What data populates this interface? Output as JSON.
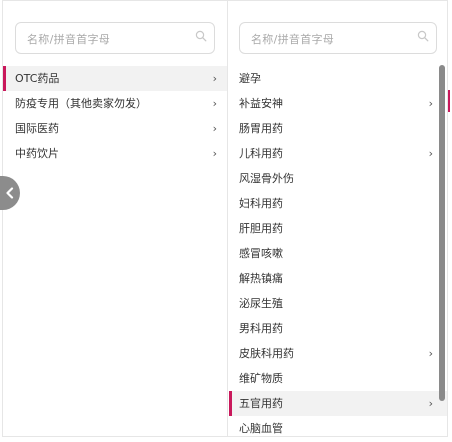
{
  "left": {
    "search_placeholder": "名称/拼音首字母",
    "items": [
      {
        "label": "OTC药品",
        "chevron": "›",
        "active": true
      },
      {
        "label": "防疫专用（其他卖家勿发）",
        "chevron": "›",
        "active": false
      },
      {
        "label": "国际医药",
        "chevron": "›",
        "active": false
      },
      {
        "label": "中药饮片",
        "chevron": "›",
        "active": false
      }
    ]
  },
  "right": {
    "search_placeholder": "名称/拼音首字母",
    "items": [
      {
        "label": "避孕",
        "chevron": "",
        "active": false
      },
      {
        "label": "补益安神",
        "chevron": "›",
        "active": false
      },
      {
        "label": "肠胃用药",
        "chevron": "",
        "active": false
      },
      {
        "label": "儿科用药",
        "chevron": "›",
        "active": false
      },
      {
        "label": "风湿骨外伤",
        "chevron": "",
        "active": false
      },
      {
        "label": "妇科用药",
        "chevron": "",
        "active": false
      },
      {
        "label": "肝胆用药",
        "chevron": "",
        "active": false
      },
      {
        "label": "感冒咳嗽",
        "chevron": "",
        "active": false
      },
      {
        "label": "解热镇痛",
        "chevron": "",
        "active": false
      },
      {
        "label": "泌尿生殖",
        "chevron": "",
        "active": false
      },
      {
        "label": "男科用药",
        "chevron": "",
        "active": false
      },
      {
        "label": "皮肤科用药",
        "chevron": "›",
        "active": false
      },
      {
        "label": "维矿物质",
        "chevron": "",
        "active": false
      },
      {
        "label": "五官用药",
        "chevron": "›",
        "active": true
      },
      {
        "label": "心脑血管",
        "chevron": "",
        "active": false
      }
    ]
  },
  "icons": {
    "search": "search-icon",
    "collapse": "chevron-left-icon"
  },
  "colors": {
    "accent": "#c9185b",
    "active_bg": "#f2f2f2",
    "handle": "#8c8c8c"
  }
}
